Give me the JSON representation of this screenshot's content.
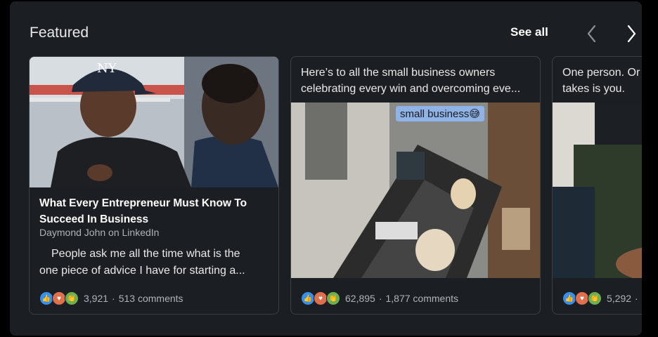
{
  "header": {
    "title": "Featured",
    "see_all": "See all",
    "prev_icon": "chevron-left-icon",
    "next_icon": "chevron-right-icon"
  },
  "cards": [
    {
      "type": "article",
      "image_alt": "Man in NY cap talking with another man",
      "title": "What Every Entrepreneur Must Know To Succeed In Business",
      "author": "Daymond John on LinkedIn",
      "snippet_line1": "People ask me all the time what is the",
      "snippet_line2": "one piece of advice I have for starting a...",
      "reaction_count": "3,921",
      "comments": "513 comments"
    },
    {
      "type": "post",
      "text_line1": "Here’s to all the small business owners",
      "text_line2": "celebrating every win and overcoming eve...",
      "image_caption": "small business😅",
      "reaction_count": "62,895",
      "comments": "1,877 comments"
    },
    {
      "type": "post",
      "text_line1": "One person. Or",
      "text_line2": "takes is you.",
      "reaction_count": "5,292",
      "comments": "·"
    }
  ],
  "colors": {
    "panel_bg": "#1b1f23",
    "card_border": "#3b4045",
    "like": "#378fe9",
    "love": "#df704d",
    "celebrate": "#6dae4f"
  }
}
